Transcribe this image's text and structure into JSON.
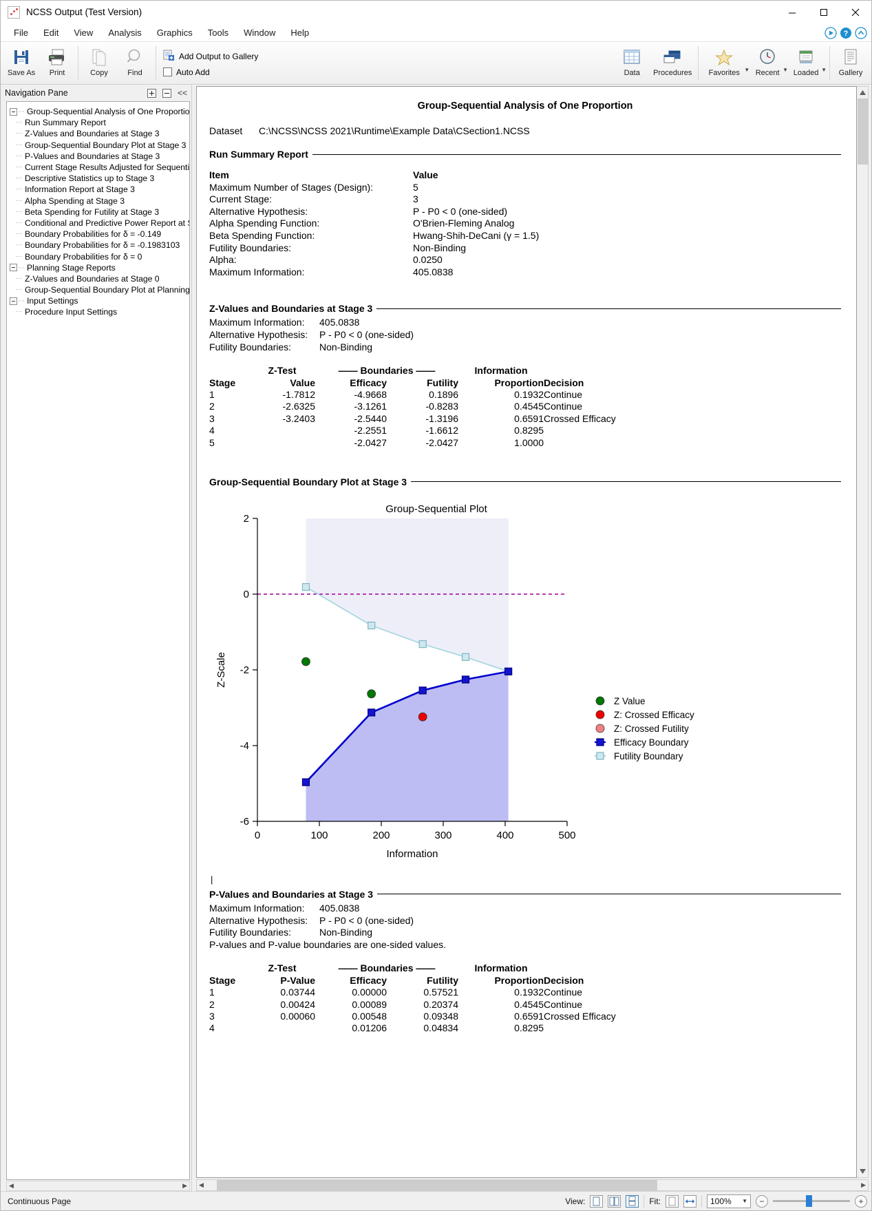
{
  "window": {
    "title": "NCSS Output (Test Version)",
    "icon": "ncss-app-icon",
    "minimize": "minimize-icon",
    "maximize": "maximize-icon",
    "close": "close-icon"
  },
  "menu": {
    "items": [
      {
        "label": "File"
      },
      {
        "label": "Edit"
      },
      {
        "label": "View"
      },
      {
        "label": "Analysis"
      },
      {
        "label": "Graphics"
      },
      {
        "label": "Tools"
      },
      {
        "label": "Window"
      },
      {
        "label": "Help"
      }
    ],
    "right_icons": [
      "play-circle-icon",
      "help-circle-icon",
      "collapse-ribbon-icon"
    ]
  },
  "toolbar": {
    "buttons": [
      {
        "label": "Save As",
        "icon": "save-icon"
      },
      {
        "label": "Print",
        "icon": "printer-icon"
      },
      {
        "label": "Copy",
        "icon": "copy-icon"
      },
      {
        "label": "Find",
        "icon": "magnifier-icon"
      }
    ],
    "gallery_add_label": "Add Output to Gallery",
    "gallery_add_icon": "add-to-gallery-icon",
    "auto_add_label": "Auto Add",
    "auto_add_checked": false,
    "right_buttons": [
      {
        "label": "Data",
        "icon": "data-grid-icon",
        "caret": false
      },
      {
        "label": "Procedures",
        "icon": "procedures-windows-icon",
        "caret": false
      },
      {
        "label": "Favorites",
        "icon": "star-icon",
        "caret": true
      },
      {
        "label": "Recent",
        "icon": "clock-icon",
        "caret": true
      },
      {
        "label": "Loaded",
        "icon": "loaded-icon",
        "caret": true
      },
      {
        "label": "Gallery",
        "icon": "gallery-icon",
        "caret": false
      }
    ]
  },
  "nav": {
    "title": "Navigation Pane",
    "expand_all_icon": "expand-all-icon",
    "collapse_all_icon": "collapse-all-icon",
    "hide_pane_icon": "chevron-double-left-icon",
    "nodes": [
      {
        "label": "Group-Sequential Analysis of One Proportion",
        "level": 0,
        "toggle": true
      },
      {
        "label": "Run Summary Report",
        "level": 1,
        "toggle": false
      },
      {
        "label": "Z-Values and Boundaries at Stage 3",
        "level": 1,
        "toggle": false
      },
      {
        "label": "Group-Sequential Boundary Plot at Stage 3",
        "level": 1,
        "toggle": false
      },
      {
        "label": "P-Values and Boundaries at Stage 3",
        "level": 1,
        "toggle": false
      },
      {
        "label": "Current Stage Results Adjusted for Sequential",
        "level": 1,
        "toggle": false
      },
      {
        "label": "Descriptive Statistics up to Stage 3",
        "level": 1,
        "toggle": false
      },
      {
        "label": "Information Report at Stage 3",
        "level": 1,
        "toggle": false
      },
      {
        "label": "Alpha Spending at Stage 3",
        "level": 1,
        "toggle": false
      },
      {
        "label": "Beta Spending for Futility at Stage 3",
        "level": 1,
        "toggle": false
      },
      {
        "label": "Conditional and Predictive Power Report at S",
        "level": 1,
        "toggle": false
      },
      {
        "label": "Boundary Probabilities for δ = -0.149",
        "level": 1,
        "toggle": false
      },
      {
        "label": "Boundary Probabilities for δ = -0.1983103",
        "level": 1,
        "toggle": false
      },
      {
        "label": "Boundary Probabilities for δ = 0",
        "level": 1,
        "toggle": false
      },
      {
        "label": "Planning Stage Reports",
        "level": 0,
        "toggle": true
      },
      {
        "label": "Z-Values and Boundaries at Stage 0",
        "level": 1,
        "toggle": false
      },
      {
        "label": "Group-Sequential Boundary Plot at Planning S",
        "level": 1,
        "toggle": false
      },
      {
        "label": "Input Settings",
        "level": 0,
        "toggle": true
      },
      {
        "label": "Procedure Input Settings",
        "level": 1,
        "toggle": false
      }
    ]
  },
  "document": {
    "title": "Group-Sequential Analysis of One Proportion",
    "dataset_label": "Dataset",
    "dataset_value": "C:\\NCSS\\NCSS 2021\\Runtime\\Example Data\\CSection1.NCSS",
    "run_summary": {
      "heading": "Run Summary Report",
      "col_item": "Item",
      "col_value": "Value",
      "rows": [
        {
          "item": "Maximum Number of Stages (Design):",
          "value": "5"
        },
        {
          "item": "Current Stage:",
          "value": "3"
        },
        {
          "item": "Alternative Hypothesis:",
          "value": "P - P0 < 0 (one-sided)"
        },
        {
          "item": "Alpha Spending Function:",
          "value": "O'Brien-Fleming Analog"
        },
        {
          "item": "Beta Spending Function:",
          "value": "Hwang-Shih-DeCani (γ = 1.5)"
        },
        {
          "item": "Futility Boundaries:",
          "value": "Non-Binding"
        },
        {
          "item": "Alpha:",
          "value": "0.0250"
        },
        {
          "item": "Maximum Information:",
          "value": "405.0838"
        }
      ]
    },
    "zvalues": {
      "heading": "Z-Values and Boundaries at Stage 3",
      "meta": [
        {
          "k": "Maximum Information:",
          "v": "405.0838"
        },
        {
          "k": "Alternative Hypothesis:",
          "v": "P - P0 < 0 (one-sided)"
        },
        {
          "k": "Futility Boundaries:",
          "v": "Non-Binding"
        }
      ],
      "group_headers": {
        "ztest": "Z-Test",
        "boundaries": "—— Boundaries ——",
        "information": "Information"
      },
      "columns": [
        "Stage",
        "Value",
        "Efficacy",
        "Futility",
        "Proportion",
        "Decision"
      ],
      "rows": [
        {
          "stage": "1",
          "value": "-1.7812",
          "efficacy": "-4.9668",
          "futility": "0.1896",
          "prop": "0.1932",
          "decision": "Continue"
        },
        {
          "stage": "2",
          "value": "-2.6325",
          "efficacy": "-3.1261",
          "futility": "-0.8283",
          "prop": "0.4545",
          "decision": "Continue"
        },
        {
          "stage": "3",
          "value": "-3.2403",
          "efficacy": "-2.5440",
          "futility": "-1.3196",
          "prop": "0.6591",
          "decision": "Crossed Efficacy"
        },
        {
          "stage": "4",
          "value": "",
          "efficacy": "-2.2551",
          "futility": "-1.6612",
          "prop": "0.8295",
          "decision": ""
        },
        {
          "stage": "5",
          "value": "",
          "efficacy": "-2.0427",
          "futility": "-2.0427",
          "prop": "1.0000",
          "decision": ""
        }
      ]
    },
    "plot_section": {
      "heading": "Group-Sequential Boundary Plot at Stage 3"
    },
    "pvalues": {
      "heading": "P-Values and Boundaries at Stage 3",
      "meta": [
        {
          "k": "Maximum Information:",
          "v": "405.0838"
        },
        {
          "k": "Alternative Hypothesis:",
          "v": "P - P0 < 0 (one-sided)"
        },
        {
          "k": "Futility Boundaries:",
          "v": "Non-Binding"
        }
      ],
      "note": "P-values and P-value boundaries are one-sided values.",
      "group_headers": {
        "ztest": "Z-Test",
        "boundaries": "—— Boundaries ——",
        "information": "Information"
      },
      "columns": [
        "Stage",
        "P-Value",
        "Efficacy",
        "Futility",
        "Proportion",
        "Decision"
      ],
      "rows": [
        {
          "stage": "1",
          "value": "0.03744",
          "efficacy": "0.00000",
          "futility": "0.57521",
          "prop": "0.1932",
          "decision": "Continue"
        },
        {
          "stage": "2",
          "value": "0.00424",
          "efficacy": "0.00089",
          "futility": "0.20374",
          "prop": "0.4545",
          "decision": "Continue"
        },
        {
          "stage": "3",
          "value": "0.00060",
          "efficacy": "0.00548",
          "futility": "0.09348",
          "prop": "0.6591",
          "decision": "Crossed Efficacy"
        },
        {
          "stage": "4",
          "value": "",
          "efficacy": "0.01206",
          "futility": "0.04834",
          "prop": "0.8295",
          "decision": ""
        }
      ]
    }
  },
  "chart_data": {
    "type": "line",
    "title": "Group-Sequential Plot",
    "xlabel": "Information",
    "ylabel": "Z-Scale",
    "xlim": [
      0,
      500
    ],
    "ylim": [
      -6,
      2
    ],
    "xticks": [
      0,
      100,
      200,
      300,
      400,
      500
    ],
    "yticks": [
      2,
      0,
      -2,
      -4,
      -6
    ],
    "grid": false,
    "legend_position": "right",
    "zero_reference_line": {
      "y": 0,
      "color": "#990099",
      "style": "dashed"
    },
    "series": [
      {
        "name": "Efficacy Boundary",
        "marker": "square",
        "color": "#0000CC",
        "fill_color": "#B9B9F5",
        "x": [
          78.3,
          184.1,
          266.9,
          336.1,
          405.1
        ],
        "y": [
          -4.9668,
          -3.1261,
          -2.544,
          -2.2551,
          -2.0427
        ]
      },
      {
        "name": "Futility Boundary",
        "marker": "square",
        "color": "#A8D8E0",
        "fill_color": "#EFEFFA",
        "x": [
          78.3,
          184.1,
          266.9,
          336.1,
          405.1
        ],
        "y": [
          0.1896,
          -0.8283,
          -1.3196,
          -1.6612,
          -2.0427
        ]
      },
      {
        "name": "Z Value",
        "marker": "circle",
        "color": "#007700",
        "x": [
          78.3,
          184.1
        ],
        "y": [
          -1.7812,
          -2.6325
        ]
      },
      {
        "name": "Z: Crossed Efficacy",
        "marker": "circle",
        "color": "#EE0000",
        "x": [
          266.9
        ],
        "y": [
          -3.2403
        ]
      },
      {
        "name": "Z: Crossed Futility",
        "marker": "circle",
        "color": "#F08080",
        "x": [],
        "y": []
      }
    ],
    "legend": [
      {
        "label": "Z Value",
        "marker": "circle",
        "color": "#007700"
      },
      {
        "label": "Z: Crossed Efficacy",
        "marker": "circle",
        "color": "#EE0000"
      },
      {
        "label": "Z: Crossed Futility",
        "marker": "circle",
        "color": "#F08080"
      },
      {
        "label": "Efficacy Boundary",
        "marker": "square-line",
        "color": "#0000CC"
      },
      {
        "label": "Futility Boundary",
        "marker": "square-line",
        "color": "#A8D8E0"
      }
    ]
  },
  "statusbar": {
    "mode": "Continuous Page",
    "view_label": "View:",
    "fit_label": "Fit:",
    "zoom_value": "100%",
    "view_icons": [
      "single-page-icon",
      "two-page-icon",
      "continuous-page-icon"
    ],
    "fit_icons": [
      "fit-page-icon",
      "fit-width-icon"
    ],
    "zoom_out_icon": "zoom-out-icon",
    "zoom_in_icon": "zoom-in-icon"
  }
}
